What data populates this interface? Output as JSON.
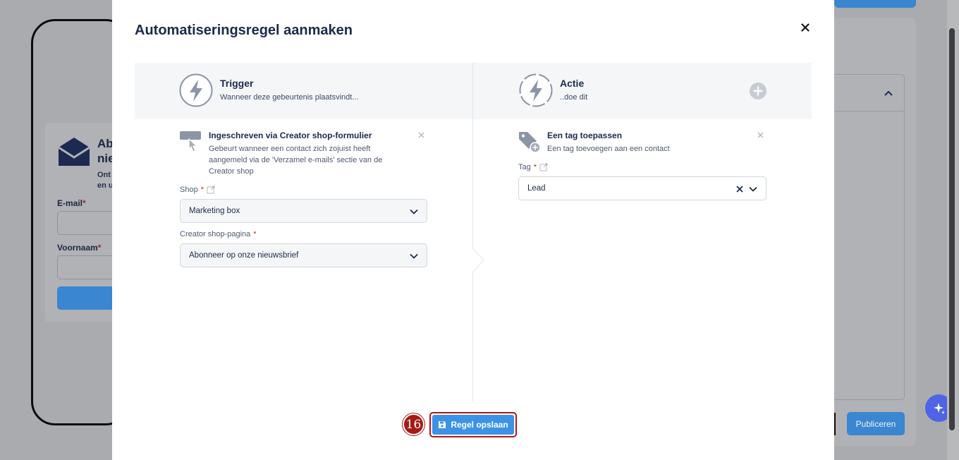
{
  "background": {
    "top_left_text": "",
    "card_title_line1": "Ab",
    "card_title_line2": "nie",
    "card_sub_line1": "Ont",
    "card_sub_line2": "en u",
    "email_label": "E-mail",
    "first_name_label": "Voornaam",
    "required_mark": "*",
    "publish_label": "Publiceren"
  },
  "modal": {
    "title": "Automatiseringsregel aanmaken",
    "trigger": {
      "title": "Trigger",
      "subtitle": "Wanneer deze gebeurtenis plaatsvindt...",
      "step_title": "Ingeschreven via Creator shop-formulier",
      "step_desc_line1": "Gebeurt wanneer een contact zich zojuist heeft",
      "step_desc_line2": "aangemeld via de 'Verzamel e-mails' sectie van de",
      "step_desc_line3": "Creator shop",
      "shop_label": "Shop",
      "shop_value": "Marketing box",
      "page_label": "Creator shop-pagina",
      "page_value": "Abonneer op onze nieuwsbrief"
    },
    "action": {
      "title": "Actie",
      "subtitle": "..doe dit",
      "step_title": "Een tag toepassen",
      "step_desc": "Een tag toevoegen aan een contact",
      "tag_label": "Tag",
      "tag_value": "Lead"
    },
    "required_mark": "*",
    "save_label": "Regel opslaan",
    "step_badge": "16"
  },
  "colors": {
    "primary": "#3c93e6",
    "title": "#1b2a4a",
    "badge": "#a31b16",
    "required": "#c2282f"
  },
  "icons": {
    "close": "close-icon",
    "bolt": "lightning-bolt-icon",
    "plus": "plus-circle-icon",
    "form_pointer": "form-pointer-icon",
    "tag_add": "tag-add-icon",
    "external_link": "external-link-icon",
    "chevron": "chevron-down-icon",
    "save": "floppy-disk-icon",
    "sparkle": "sparkle-icon"
  }
}
